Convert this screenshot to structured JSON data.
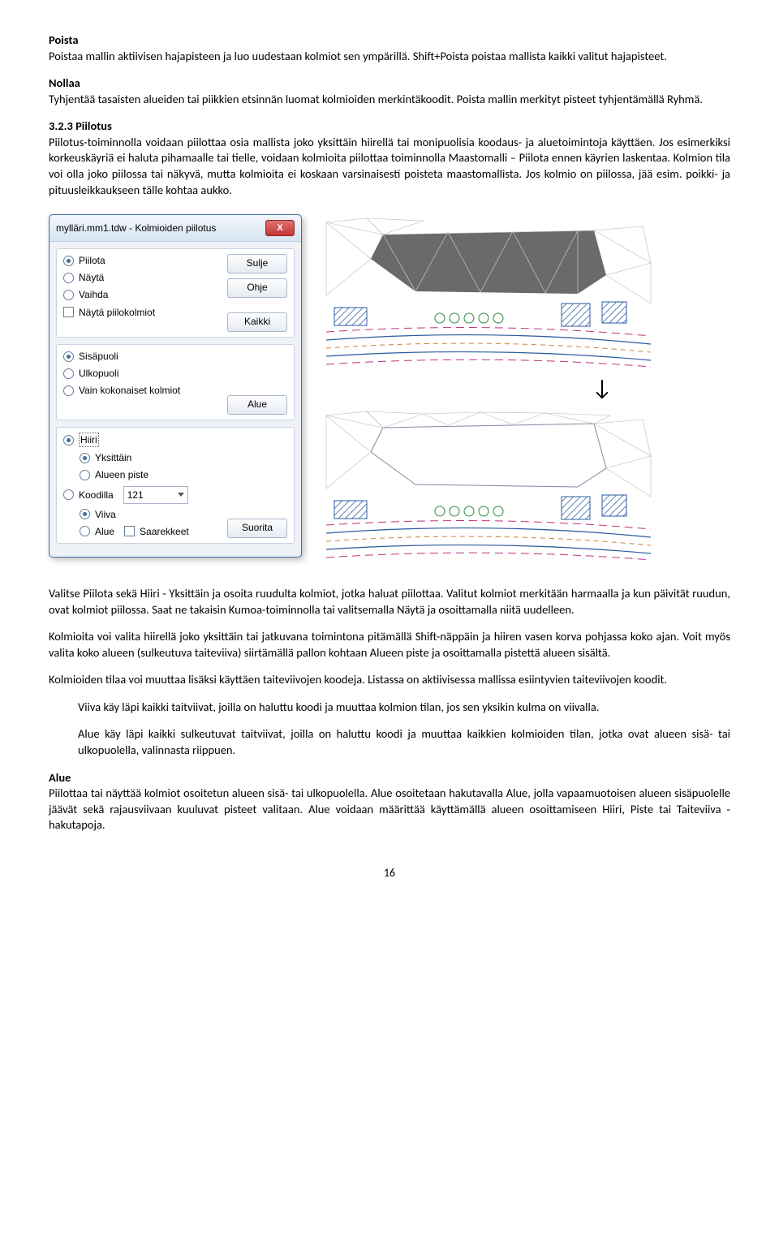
{
  "headings": {
    "poista": "Poista",
    "nollaa": "Nollaa",
    "section": "3.2.3 Piilotus",
    "alue": "Alue"
  },
  "paragraphs": {
    "poista_body": "Poistaa mallin aktiivisen hajapisteen ja luo uudestaan kolmiot sen ympärillä. Shift+Poista poistaa mallista kaikki valitut hajapisteet.",
    "nollaa_body": "Tyhjentää tasaisten alueiden tai piikkien etsinnän luomat kolmioiden merkintäkoodit. Poista mallin merkityt pisteet tyhjentämällä Ryhmä.",
    "piilotus_body1": "Piilotus-toiminnolla voidaan piilottaa osia mallista joko yksittäin hiirellä tai monipuolisia koodaus- ja aluetoimintoja käyttäen. Jos esimerkiksi korkeuskäyriä ei haluta pihamaalle tai tielle, voidaan kolmioita piilottaa toiminnolla Maastomalli – Piilota ennen käyrien laskentaa. Kolmion tila voi olla joko piilossa tai näkyvä, mutta kolmioita ei koskaan varsinaisesti poisteta maastomallista. Jos kolmio on piilossa, jää esim. poikki- ja pituusleikkaukseen tälle kohtaa aukko.",
    "valitse": "Valitse Piilota sekä Hiiri - Yksittäin ja osoita ruudulta kolmiot, jotka haluat piilottaa. Valitut kolmiot merkitään harmaalla ja kun päivität ruudun, ovat kolmiot piilossa. Saat ne takaisin Kumoa-toiminnolla tai valitsemalla Näytä ja osoittamalla niitä uudelleen.",
    "kolmioita": "Kolmioita voi valita hiirellä joko yksittäin tai jatkuvana toimintona pitämällä Shift-näppäin ja hiiren vasen korva pohjassa koko ajan. Voit myös valita koko alueen (sulkeutuva taiteviiva) siirtämällä pallon kohtaan Alueen piste ja osoittamalla pistettä alueen sisältä.",
    "kolmioiden": "Kolmioiden tilaa voi muuttaa lisäksi käyttäen taiteviivojen koodeja. Listassa on aktiivisessa mallissa esiintyvien taiteviivojen koodit.",
    "viiva": "Viiva käy läpi kaikki taitviivat, joilla on haluttu koodi ja muuttaa kolmion tilan, jos sen yksikin kulma on viivalla.",
    "alue_inner": "Alue käy läpi kaikki sulkeutuvat taitviivat, joilla on haluttu koodi ja muuttaa kaikkien kolmioiden tilan, jotka ovat alueen sisä- tai ulkopuolella, valinnasta riippuen.",
    "alue_body": "Piilottaa tai näyttää kolmiot osoitetun alueen sisä- tai ulkopuolella. Alue osoitetaan hakutavalla Alue, jolla vapaamuotoisen alueen sisäpuolelle jäävät sekä rajausviivaan kuuluvat pisteet valitaan. Alue voidaan määrittää käyttämällä alueen osoittamiseen Hiiri, Piste tai Taiteviiva -hakutapoja."
  },
  "dialog": {
    "title": "mylläri.mm1.tdw - Kolmioiden piilotus",
    "close": "X",
    "radios1": {
      "piilota": "Piilota",
      "nayta": "Näytä",
      "vaihda": "Vaihda"
    },
    "check1": "Näytä piilokolmiot",
    "buttons": {
      "sulje": "Sulje",
      "ohje": "Ohje",
      "kaikki": "Kaikki",
      "alue": "Alue",
      "suorita": "Suorita"
    },
    "radios2": {
      "sisa": "Sisäpuoli",
      "ulko": "Ulkopuoli",
      "vain": "Vain kokonaiset kolmiot"
    },
    "radios3": {
      "hiiri": "Hiiri",
      "yksittain": "Yksittäin",
      "alueenpiste": "Alueen piste",
      "koodilla": "Koodilla",
      "viiva": "Viiva",
      "alue": "Alue",
      "saarekkeet": "Saarekkeet"
    },
    "combo_value": "121"
  },
  "figure": {
    "arrow": "↓"
  },
  "page_number": "16"
}
